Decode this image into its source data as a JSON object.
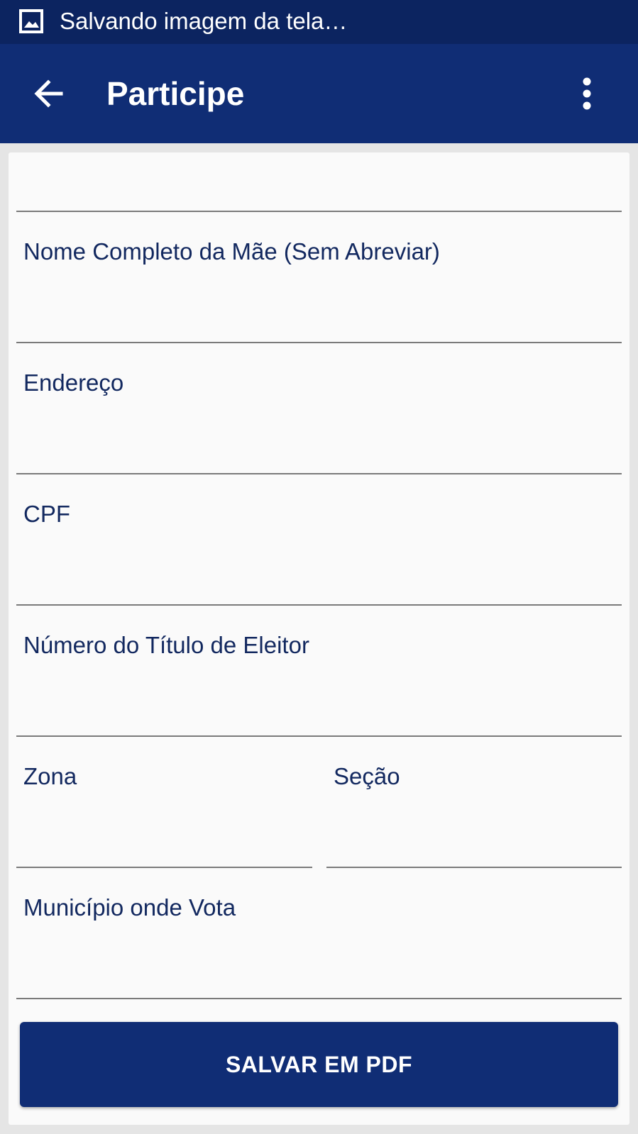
{
  "status_bar": {
    "icon": "image-icon",
    "text": "Salvando imagem da tela…"
  },
  "app_bar": {
    "back_icon": "arrow-left-icon",
    "title": "Participe",
    "menu_icon": "more-vert-icon"
  },
  "form": {
    "fields": [
      {
        "label": ""
      },
      {
        "label": "Nome Completo da Mãe (Sem Abreviar)"
      },
      {
        "label": "Endereço"
      },
      {
        "label": "CPF"
      },
      {
        "label": "Número do Título de Eleitor"
      },
      {
        "label": "Zona"
      },
      {
        "label": "Seção"
      },
      {
        "label": "Município onde Vota"
      }
    ]
  },
  "actions": {
    "save_pdf_label": "SALVAR EM PDF"
  },
  "colors": {
    "status_bar": "#0c2460",
    "primary": "#102d75",
    "label_text": "#12285f",
    "card_background": "#fafafa",
    "page_background": "#e5e5e5"
  }
}
